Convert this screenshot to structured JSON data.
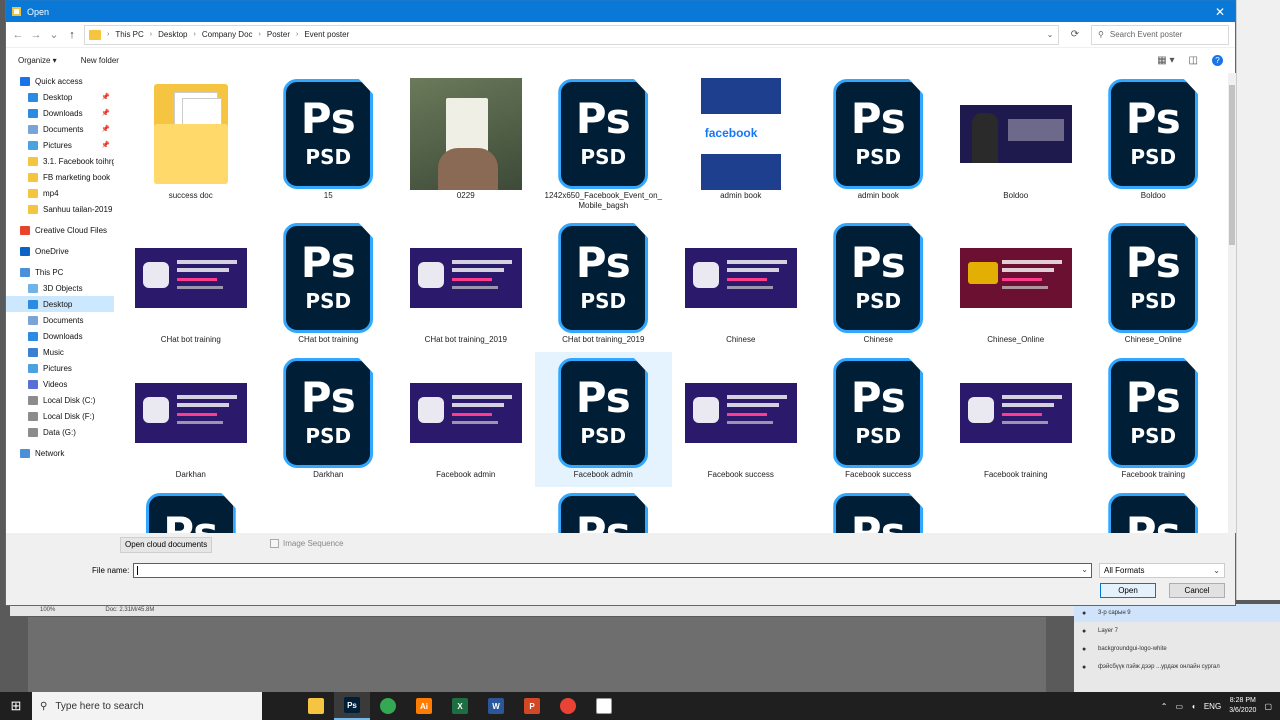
{
  "title": "Open",
  "breadcrumbs": [
    "This PC",
    "Desktop",
    "Company Doc",
    "Poster",
    "Event poster"
  ],
  "search_placeholder": "Search Event poster",
  "toolbar": {
    "organize": "Organize ▾",
    "new_folder": "New folder"
  },
  "nav": [
    {
      "label": "Quick access",
      "icon": "star-icon",
      "color": "#1a73e8",
      "sub": false
    },
    {
      "label": "Desktop",
      "icon": "desktop-icon",
      "color": "#2b8ae2",
      "sub": true,
      "pin": true
    },
    {
      "label": "Downloads",
      "icon": "download-icon",
      "color": "#2b8ae2",
      "sub": true,
      "pin": true
    },
    {
      "label": "Documents",
      "icon": "documents-icon",
      "color": "#7aa4d6",
      "sub": true,
      "pin": true
    },
    {
      "label": "Pictures",
      "icon": "pictures-icon",
      "color": "#4aa3df",
      "sub": true,
      "pin": true
    },
    {
      "label": "3.1. Facebook toihrg",
      "icon": "folder-icon",
      "color": "#f5c542",
      "sub": true
    },
    {
      "label": "FB marketing book",
      "icon": "folder-icon",
      "color": "#f5c542",
      "sub": true
    },
    {
      "label": "mp4",
      "icon": "folder-icon",
      "color": "#f5c542",
      "sub": true
    },
    {
      "label": "Sanhuu tailan-2019",
      "icon": "folder-icon",
      "color": "#f5c542",
      "sub": true
    },
    {
      "gap": true
    },
    {
      "label": "Creative Cloud Files",
      "icon": "creative-cloud-icon",
      "color": "#e8442c",
      "sub": false
    },
    {
      "gap": true
    },
    {
      "label": "OneDrive",
      "icon": "onedrive-icon",
      "color": "#0a64c8",
      "sub": false
    },
    {
      "gap": true
    },
    {
      "label": "This PC",
      "icon": "computer-icon",
      "color": "#4a90d9",
      "sub": false
    },
    {
      "label": "3D Objects",
      "icon": "3d-objects-icon",
      "color": "#6fb3e8",
      "sub": true
    },
    {
      "label": "Desktop",
      "icon": "desktop-icon",
      "color": "#2b8ae2",
      "sub": true,
      "selected": true
    },
    {
      "label": "Documents",
      "icon": "documents-icon",
      "color": "#7aa4d6",
      "sub": true
    },
    {
      "label": "Downloads",
      "icon": "download-icon",
      "color": "#2b8ae2",
      "sub": true
    },
    {
      "label": "Music",
      "icon": "music-icon",
      "color": "#3b7fd0",
      "sub": true
    },
    {
      "label": "Pictures",
      "icon": "pictures-icon",
      "color": "#4aa3df",
      "sub": true
    },
    {
      "label": "Videos",
      "icon": "videos-icon",
      "color": "#5b6ed6",
      "sub": true
    },
    {
      "label": "Local Disk (C:)",
      "icon": "disk-icon",
      "color": "#8c8c8c",
      "sub": true
    },
    {
      "label": "Local Disk (F:)",
      "icon": "disk-icon",
      "color": "#8c8c8c",
      "sub": true
    },
    {
      "label": "Data (G:)",
      "icon": "disk-icon",
      "color": "#8c8c8c",
      "sub": true
    },
    {
      "gap": true
    },
    {
      "label": "Network",
      "icon": "network-icon",
      "color": "#4a90d9",
      "sub": false
    }
  ],
  "files": [
    {
      "name": "success doc",
      "kind": "doc"
    },
    {
      "name": "15",
      "kind": "psd"
    },
    {
      "name": "0229",
      "kind": "photo"
    },
    {
      "name": "1242x650_Facebook_Event_on_Mobile_bagsh",
      "kind": "psd"
    },
    {
      "name": "admin book",
      "kind": "book",
      "text": "facebook"
    },
    {
      "name": "admin book",
      "kind": "psd"
    },
    {
      "name": "Boldoo",
      "kind": "portrait"
    },
    {
      "name": "Boldoo",
      "kind": "psd"
    },
    {
      "name": "CHat bot training",
      "kind": "banner"
    },
    {
      "name": "CHat bot training",
      "kind": "psd"
    },
    {
      "name": "CHat bot training_2019",
      "kind": "banner"
    },
    {
      "name": "CHat bot training_2019",
      "kind": "psd"
    },
    {
      "name": "Chinese",
      "kind": "banner"
    },
    {
      "name": "Chinese",
      "kind": "psd"
    },
    {
      "name": "Chinese_Online",
      "kind": "banner-red"
    },
    {
      "name": "Chinese_Online",
      "kind": "psd"
    },
    {
      "name": "Darkhan",
      "kind": "banner"
    },
    {
      "name": "Darkhan",
      "kind": "psd"
    },
    {
      "name": "Facebook admin",
      "kind": "banner"
    },
    {
      "name": "Facebook admin",
      "kind": "psd",
      "selected": true
    },
    {
      "name": "Facebook success",
      "kind": "banner"
    },
    {
      "name": "Facebook success",
      "kind": "psd"
    },
    {
      "name": "Facebook training",
      "kind": "banner"
    },
    {
      "name": "Facebook training",
      "kind": "psd"
    },
    {
      "name": "",
      "kind": "psd-partial"
    },
    {
      "name": "",
      "kind": "empty"
    },
    {
      "name": "",
      "kind": "empty"
    },
    {
      "name": "",
      "kind": "psd-partial"
    },
    {
      "name": "",
      "kind": "empty"
    },
    {
      "name": "",
      "kind": "psd-partial"
    },
    {
      "name": "",
      "kind": "empty"
    },
    {
      "name": "",
      "kind": "psd-partial"
    }
  ],
  "psd": {
    "line1": "Ps",
    "line2": "PSD"
  },
  "bottom": {
    "cloud_button": "Open cloud documents",
    "image_sequence": "Image Sequence",
    "filename_label": "File name:",
    "filename_value": "",
    "format": "All Formats",
    "open": "Open",
    "cancel": "Cancel"
  },
  "background": {
    "zoom": "100%",
    "doc": "Doc: 2.31M/45.8M",
    "layers": [
      {
        "name": "3-р сарын 9",
        "selected": true
      },
      {
        "name": "Layer 7"
      },
      {
        "name": "backgroundgui-logo-white"
      },
      {
        "name": "фэйсбүүк пэйж дээр ...урдаж онлайн сургал"
      }
    ]
  },
  "taskbar": {
    "search_placeholder": "Type here to search",
    "apps": [
      {
        "label": "",
        "icon": "task-view-icon",
        "color": "#1f1f1f"
      },
      {
        "label": "",
        "icon": "file-explorer-icon",
        "color": "#f5c542"
      },
      {
        "label": "Ps",
        "icon": "photoshop-icon",
        "color": "#001e36",
        "active": true
      },
      {
        "label": "",
        "icon": "chrome-icon",
        "color": "#34a853"
      },
      {
        "label": "Ai",
        "icon": "illustrator-icon",
        "color": "#ff7c00"
      },
      {
        "label": "X",
        "icon": "excel-icon",
        "color": "#1d6f42"
      },
      {
        "label": "W",
        "icon": "word-icon",
        "color": "#2b579a"
      },
      {
        "label": "P",
        "icon": "powerpoint-icon",
        "color": "#d24726"
      },
      {
        "label": "",
        "icon": "chrome-icon",
        "color": "#ea4335"
      },
      {
        "label": "",
        "icon": "notepad-icon",
        "color": "#ffffff"
      }
    ],
    "language": "ENG",
    "time": "8:28 PM",
    "date": "3/6/2020"
  }
}
